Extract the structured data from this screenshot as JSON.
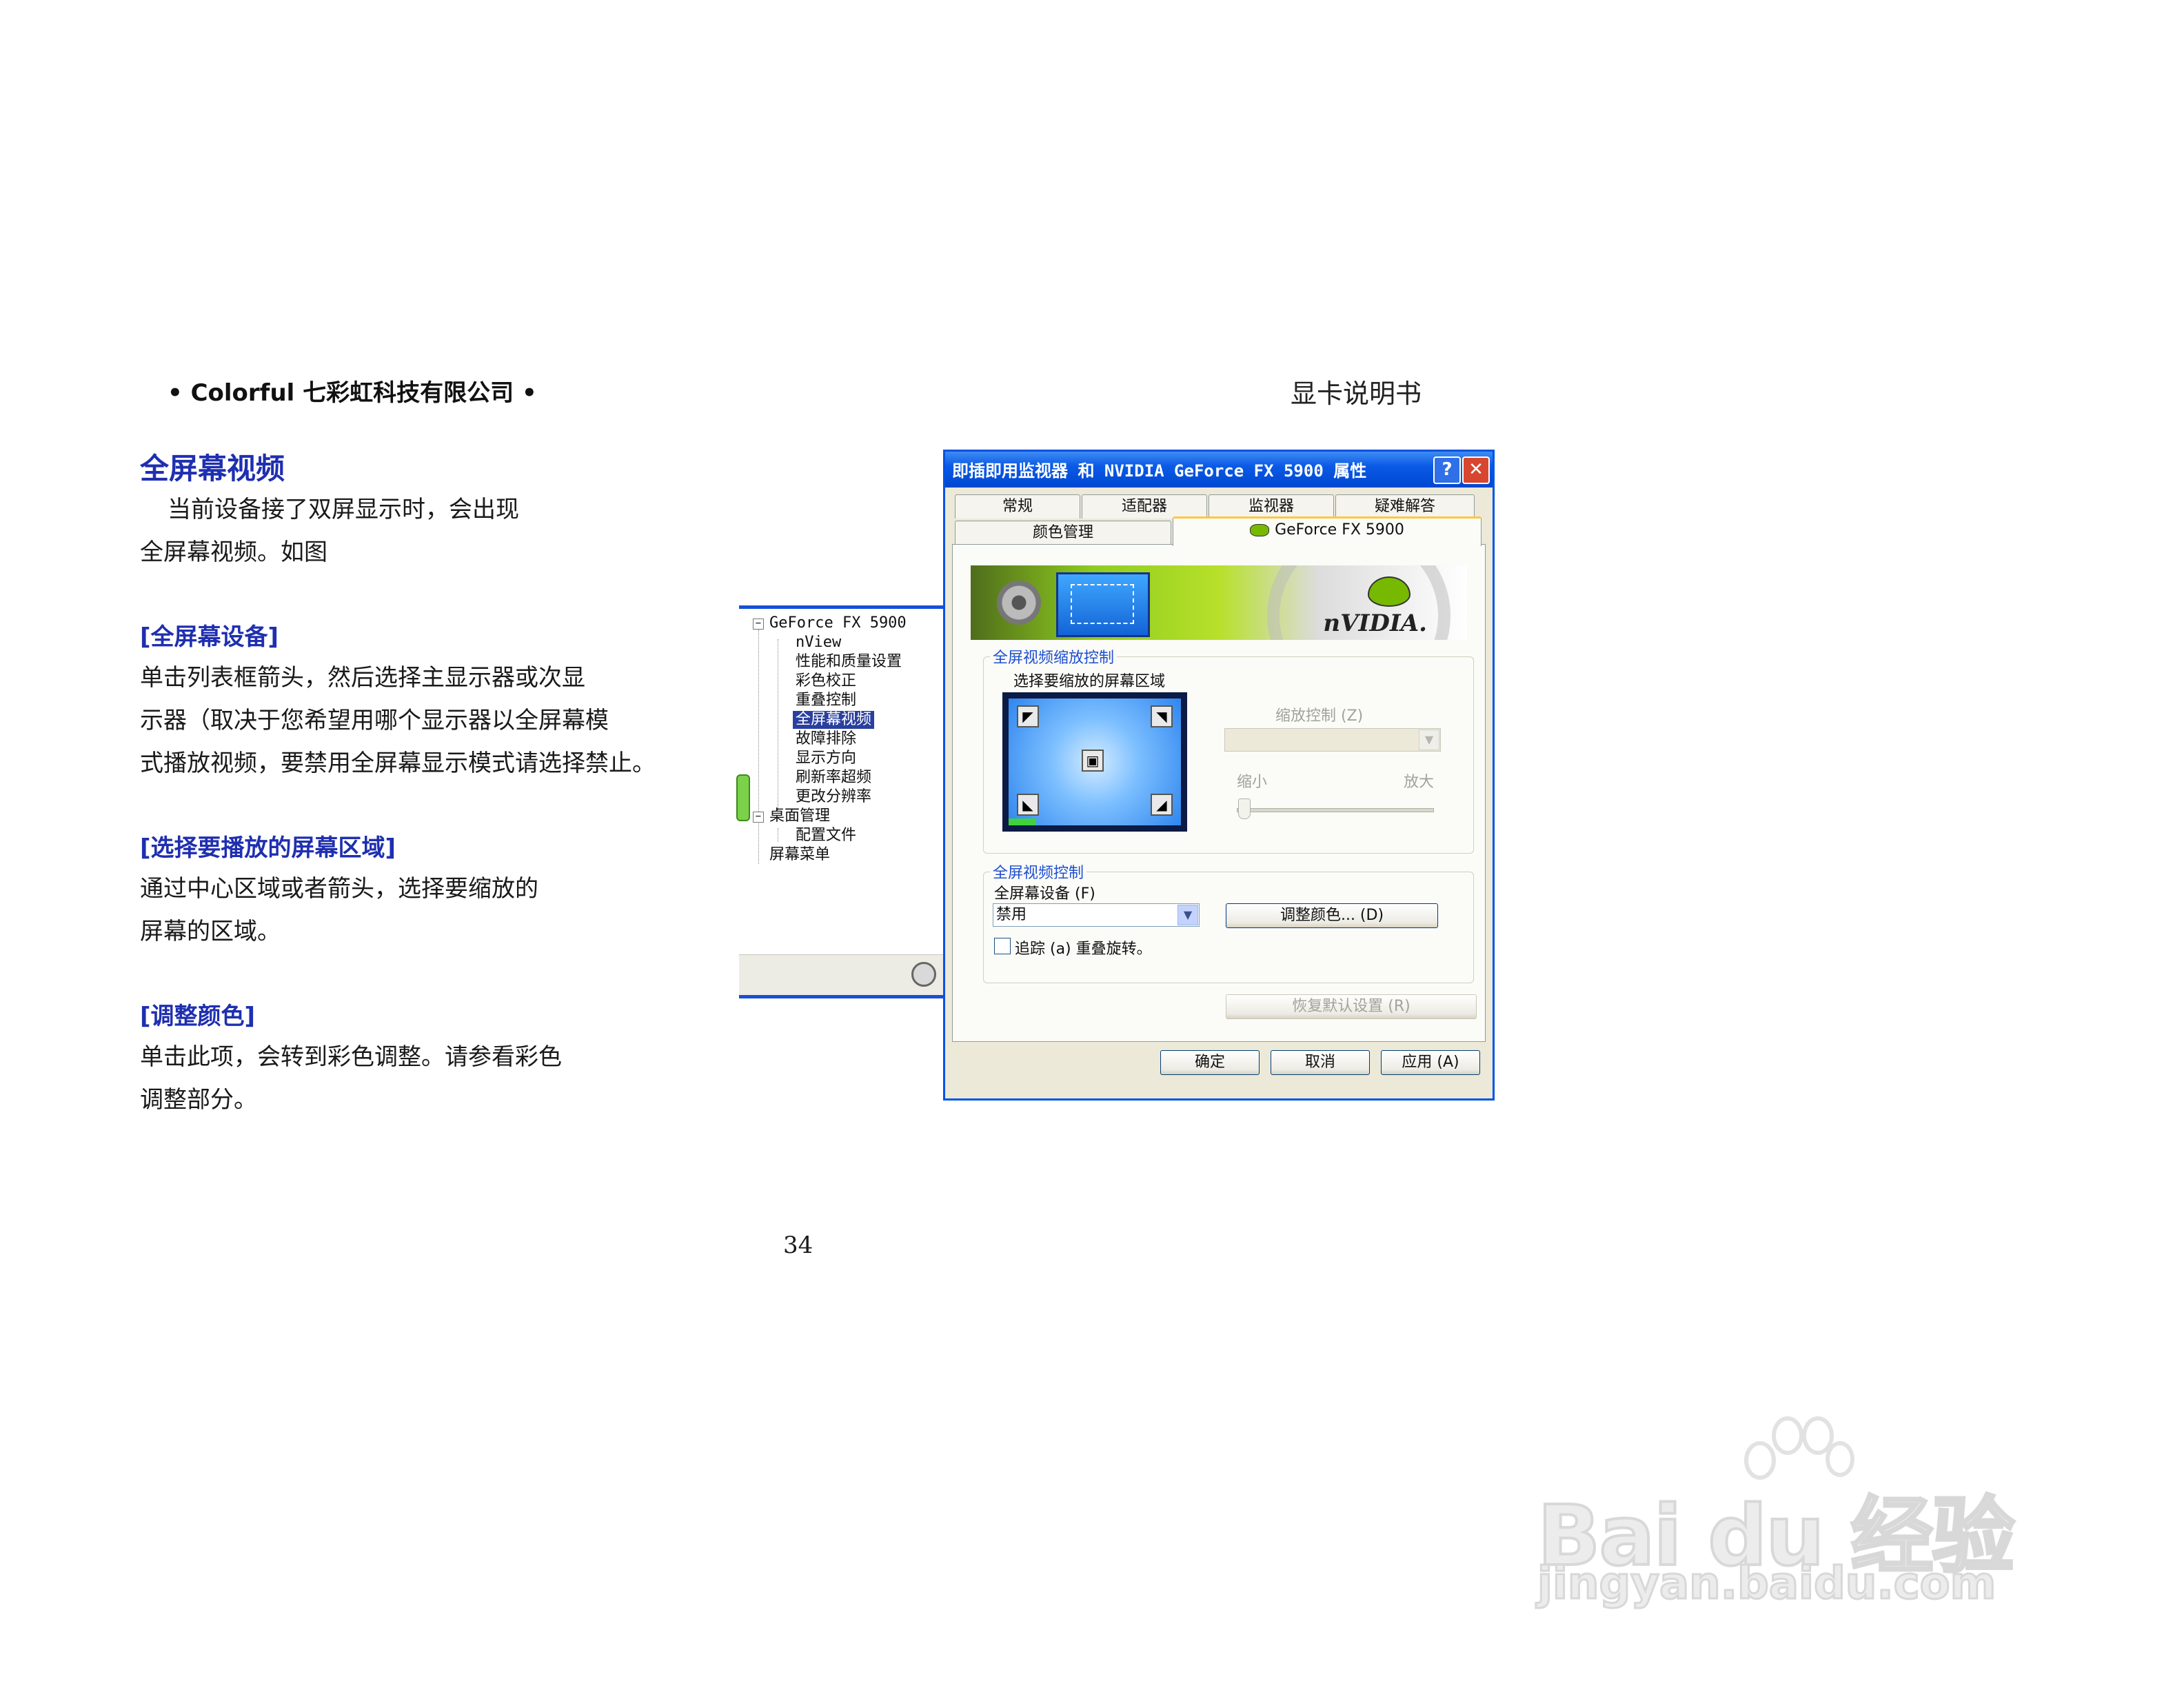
{
  "header": {
    "company": "• Colorful  七彩虹科技有限公司 •",
    "doc_title": "显卡说明书"
  },
  "content": {
    "title": "全屏幕视频",
    "intro_lines": [
      "当前设备接了双屏显示时，会出现",
      "全屏幕视频。如图"
    ],
    "sections": [
      {
        "heading": "[全屏幕设备]",
        "lines": [
          "单击列表框箭头，然后选择主显示器或次显",
          "示器（取决于您希望用哪个显示器以全屏幕模",
          "式播放视频，要禁用全屏幕显示模式请选择禁止。"
        ]
      },
      {
        "heading": "[选择要播放的屏幕区域]",
        "lines": [
          "通过中心区域或者箭头，选择要缩放的",
          "屏幕的区域。"
        ]
      },
      {
        "heading": "[调整颜色]",
        "lines": [
          "单击此项，会转到彩色调整。请参看彩色",
          "调整部分。"
        ]
      }
    ]
  },
  "page_number": "34",
  "tree": {
    "items": [
      {
        "label": "GeForce FX 5900",
        "level": 0,
        "toggle": "−"
      },
      {
        "label": "nView",
        "level": 1
      },
      {
        "label": "性能和质量设置",
        "level": 1
      },
      {
        "label": "彩色校正",
        "level": 1
      },
      {
        "label": "重叠控制",
        "level": 1
      },
      {
        "label": "全屏幕视频",
        "level": 1,
        "selected": true
      },
      {
        "label": "故障排除",
        "level": 1
      },
      {
        "label": "显示方向",
        "level": 1
      },
      {
        "label": "刷新率超频",
        "level": 1
      },
      {
        "label": "更改分辨率",
        "level": 1
      },
      {
        "label": "桌面管理",
        "level": 0,
        "toggle": "−"
      },
      {
        "label": "配置文件",
        "level": 1
      },
      {
        "label": "屏幕菜单",
        "level": 0
      }
    ]
  },
  "dialog": {
    "title": "即插即用监视器 和 NVIDIA GeForce FX 5900 属性",
    "help_btn": "?",
    "close_btn": "✕",
    "tabs_row1": [
      "常规",
      "适配器",
      "监视器",
      "疑难解答"
    ],
    "tabs_row2": [
      "颜色管理",
      "GeForce FX 5900"
    ],
    "banner_logo": "nVIDIA.",
    "zoom_group": {
      "title": "全屏视频缩放控制",
      "select_label": "选择要缩放的屏幕区域",
      "zoom_label": "缩放控制 (Z)",
      "zoom_out": "缩小",
      "zoom_in": "放大"
    },
    "video_group": {
      "title": "全屏视频控制",
      "device_label": "全屏幕设备 (F)",
      "device_value": "禁用",
      "adjust_btn": "调整颜色... (D)",
      "track_label": "追踪 (a) 重叠旋转。"
    },
    "restore_btn": "恢复默认设置 (R)",
    "ok_btn": "确定",
    "cancel_btn": "取消",
    "apply_btn": "应用 (A)"
  },
  "watermark": {
    "brand": "Bai du 经验",
    "url": "jingyan.baidu.com"
  }
}
